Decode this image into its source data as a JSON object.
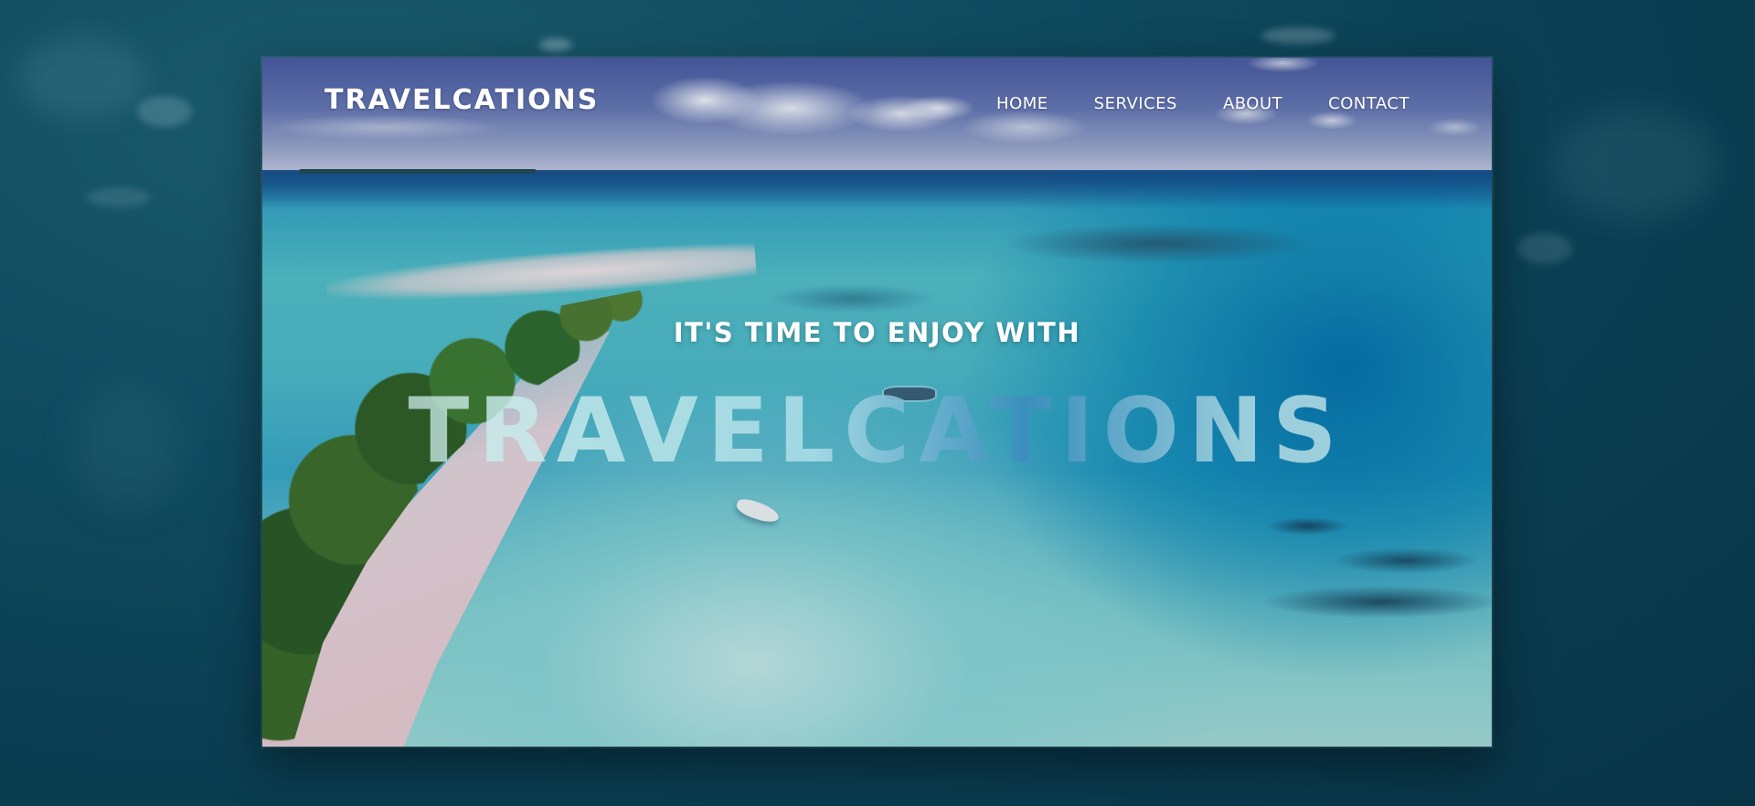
{
  "nav": {
    "logo": "TRAVELCATIONS",
    "links": [
      {
        "label": "HOME"
      },
      {
        "label": "SERVICES"
      },
      {
        "label": "ABOUT"
      },
      {
        "label": "CONTACT"
      }
    ]
  },
  "hero": {
    "subtitle": "IT'S TIME TO ENJOY WITH",
    "title": "TRAVELCATIONS",
    "background": "tropical beach aerial photo"
  },
  "colors": {
    "text": "#ffffff",
    "page_background": "#0a3c50"
  }
}
